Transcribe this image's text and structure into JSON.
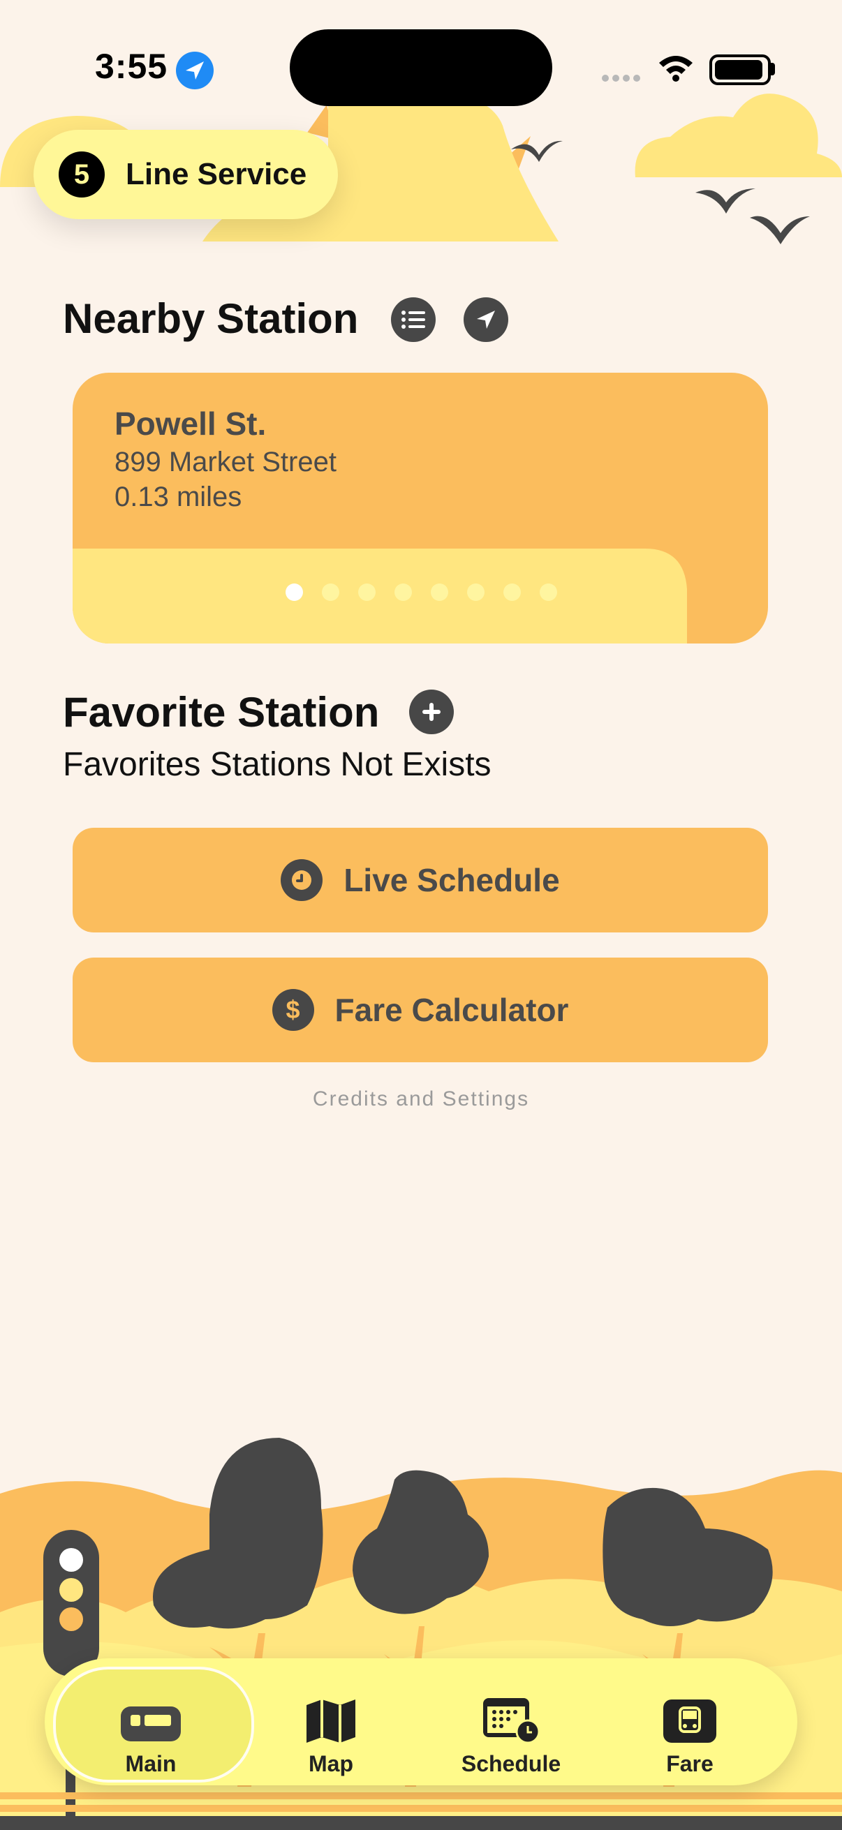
{
  "status_bar": {
    "time": "3:55"
  },
  "line_pill": {
    "number": "5",
    "label": "Line Service"
  },
  "nearby": {
    "title": "Nearby Station",
    "station_name": "Powell St.",
    "address": "899 Market Street",
    "distance": "0.13 miles",
    "page_count": 8,
    "current_page": 1
  },
  "favorite": {
    "title": "Favorite Station",
    "empty_text": "Favorites Stations Not Exists"
  },
  "actions": {
    "live_schedule": "Live Schedule",
    "fare_calculator": "Fare Calculator",
    "fare_symbol": "$"
  },
  "credits": "Credits  and  Settings",
  "tabs": [
    {
      "label": "Main",
      "icon": "train-icon",
      "selected": true
    },
    {
      "label": "Map",
      "icon": "map-icon",
      "selected": false
    },
    {
      "label": "Schedule",
      "icon": "calendar-clock-icon",
      "selected": false
    },
    {
      "label": "Fare",
      "icon": "bus-icon",
      "selected": false
    }
  ],
  "colors": {
    "background": "#fcf3ea",
    "accent_orange": "#fbbd5d",
    "accent_yellow": "#ffe680",
    "dark": "#474747"
  }
}
